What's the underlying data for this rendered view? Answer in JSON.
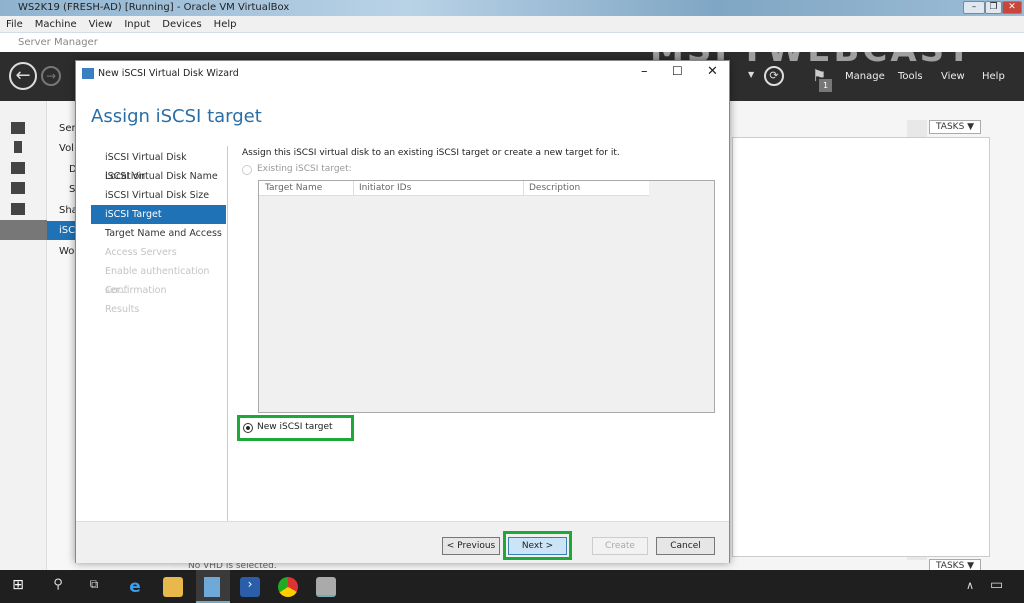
{
  "vbox": {
    "title": "WS2K19 (FRESH-AD) [Running] - Oracle VM VirtualBox",
    "menu": [
      "File",
      "Machine",
      "View",
      "Input",
      "Devices",
      "Help"
    ]
  },
  "server_manager": {
    "title": "Server Manager",
    "watermark": "MSFTWEBCAST",
    "header_menu": [
      "Manage",
      "Tools",
      "View",
      "Help"
    ],
    "flag_count": "1",
    "tasks_label": "TASKS",
    "panel_items": [
      "Ser",
      "Vol",
      "D",
      "S",
      "Sha",
      "iSC",
      "Wo"
    ],
    "status": "No VHD is selected."
  },
  "wizard": {
    "title": "New iSCSI Virtual Disk Wizard",
    "heading": "Assign iSCSI target",
    "steps": [
      {
        "label": "iSCSI Virtual Disk Location",
        "state": "done"
      },
      {
        "label": "iSCSI Virtual Disk Name",
        "state": "done"
      },
      {
        "label": "iSCSI Virtual Disk Size",
        "state": "done"
      },
      {
        "label": "iSCSI Target",
        "state": "selected"
      },
      {
        "label": "Target Name and Access",
        "state": "enabled"
      },
      {
        "label": "Access Servers",
        "state": "disabled"
      },
      {
        "label": "Enable authentication ser...",
        "state": "disabled"
      },
      {
        "label": "Confirmation",
        "state": "disabled"
      },
      {
        "label": "Results",
        "state": "disabled"
      }
    ],
    "description": "Assign this iSCSI virtual disk to an existing iSCSI target or create a new target for it.",
    "existing_option": "Existing iSCSI target:",
    "columns": [
      "Target Name",
      "Initiator IDs",
      "Description"
    ],
    "new_option": "New iSCSI target",
    "buttons": {
      "previous": "< Previous",
      "next": "Next >",
      "create": "Create",
      "cancel": "Cancel"
    }
  },
  "colors": {
    "highlight": "#1e72b5",
    "green_box": "#1fa83a"
  }
}
